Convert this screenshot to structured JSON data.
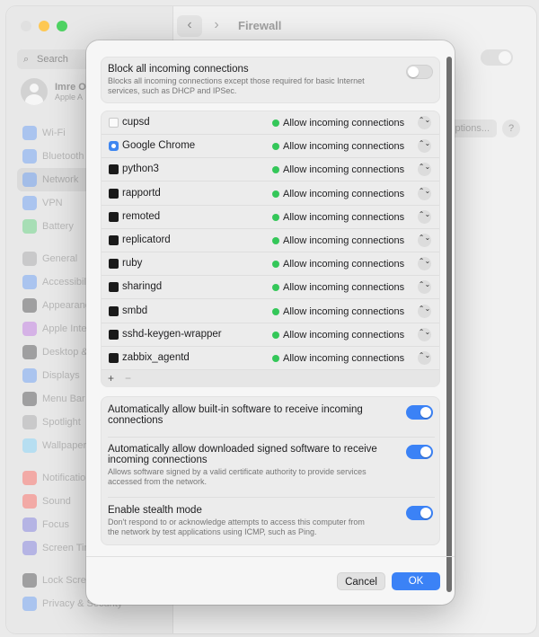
{
  "window": {
    "title": "Firewall",
    "back_glyph": "‹",
    "forward_glyph": "›",
    "options_label": "Options...",
    "help_label": "?"
  },
  "sidebar": {
    "search_placeholder": "Search",
    "user": {
      "name": "Imre O",
      "subtitle": "Apple A"
    },
    "items": [
      {
        "label": "Wi-Fi",
        "icon": "wifi-icon",
        "color": "#3b82f6"
      },
      {
        "label": "Bluetooth",
        "icon": "bluetooth-icon",
        "color": "#3b82f6"
      },
      {
        "label": "Network",
        "icon": "network-icon",
        "color": "#3b82f6"
      },
      {
        "label": "VPN",
        "icon": "vpn-icon",
        "color": "#3b82f6"
      },
      {
        "label": "Battery",
        "icon": "battery-icon",
        "color": "#34c759"
      },
      {
        "label": "General",
        "icon": "gear-icon",
        "color": "#8e8e93"
      },
      {
        "label": "Accessibili",
        "icon": "accessibility-icon",
        "color": "#3b82f6"
      },
      {
        "label": "Appearanc",
        "icon": "appearance-icon",
        "color": "#1d1d1f"
      },
      {
        "label": "Apple Inte",
        "icon": "apple-intelligence-icon",
        "color": "#af52de"
      },
      {
        "label": "Desktop &",
        "icon": "desktop-icon",
        "color": "#1d1d1f"
      },
      {
        "label": "Displays",
        "icon": "displays-icon",
        "color": "#3b82f6"
      },
      {
        "label": "Menu Bar",
        "icon": "menubar-icon",
        "color": "#1d1d1f"
      },
      {
        "label": "Spotlight",
        "icon": "spotlight-icon",
        "color": "#8e8e93"
      },
      {
        "label": "Wallpaper",
        "icon": "wallpaper-icon",
        "color": "#5ac8fa"
      },
      {
        "label": "Notificatio",
        "icon": "notifications-icon",
        "color": "#ff3b30"
      },
      {
        "label": "Sound",
        "icon": "sound-icon",
        "color": "#ff3b30"
      },
      {
        "label": "Focus",
        "icon": "focus-icon",
        "color": "#5856d6"
      },
      {
        "label": "Screen Tin",
        "icon": "screentime-icon",
        "color": "#5856d6"
      },
      {
        "label": "Lock Scree",
        "icon": "lock-screen-icon",
        "color": "#1d1d1f"
      },
      {
        "label": "Privacy & Security",
        "icon": "privacy-icon",
        "color": "#3b82f6"
      }
    ]
  },
  "sheet": {
    "block_all": {
      "title": "Block all incoming connections",
      "desc": "Blocks all incoming connections except those required for basic Internet services, such as DHCP and IPSec.",
      "enabled": false
    },
    "apps": [
      {
        "name": "cupsd",
        "icon": "document-icon",
        "status": "Allow incoming connections"
      },
      {
        "name": "Google Chrome",
        "icon": "chrome-icon",
        "status": "Allow incoming connections"
      },
      {
        "name": "python3",
        "icon": "terminal-icon",
        "status": "Allow incoming connections"
      },
      {
        "name": "rapportd",
        "icon": "terminal-icon",
        "status": "Allow incoming connections"
      },
      {
        "name": "remoted",
        "icon": "terminal-icon",
        "status": "Allow incoming connections"
      },
      {
        "name": "replicatord",
        "icon": "terminal-icon",
        "status": "Allow incoming connections"
      },
      {
        "name": "ruby",
        "icon": "terminal-icon",
        "status": "Allow incoming connections"
      },
      {
        "name": "sharingd",
        "icon": "terminal-icon",
        "status": "Allow incoming connections"
      },
      {
        "name": "smbd",
        "icon": "terminal-icon",
        "status": "Allow incoming connections"
      },
      {
        "name": "sshd-keygen-wrapper",
        "icon": "terminal-icon",
        "status": "Allow incoming connections"
      },
      {
        "name": "zabbix_agentd",
        "icon": "terminal-icon",
        "status": "Allow incoming connections"
      }
    ],
    "add_label": "+",
    "remove_label": "−",
    "stepper_glyph": "⌃⌄",
    "options": [
      {
        "title": "Automatically allow built-in software to receive incoming connections",
        "desc": "",
        "enabled": true
      },
      {
        "title": "Automatically allow downloaded signed software to receive incoming connections",
        "desc": "Allows software signed by a valid certificate authority to provide services accessed from the network.",
        "enabled": true
      },
      {
        "title": "Enable stealth mode",
        "desc": "Don't respond to or acknowledge attempts to access this computer from the network by test applications using ICMP, such as Ping.",
        "enabled": true
      }
    ],
    "cancel_label": "Cancel",
    "ok_label": "OK"
  }
}
